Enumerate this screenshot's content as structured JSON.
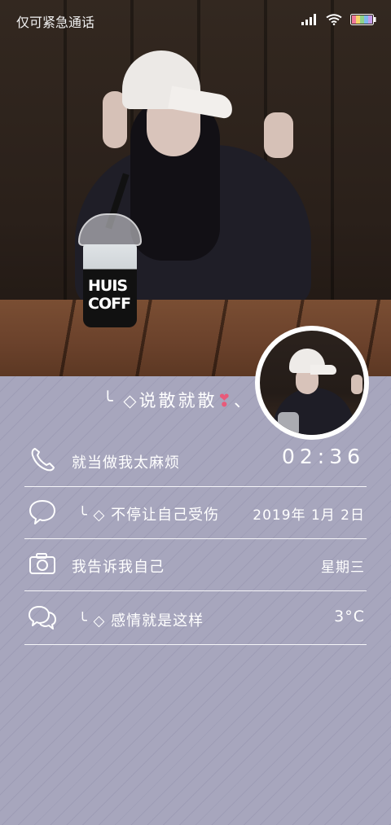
{
  "status_bar": {
    "carrier_text": "仅可紧急通话",
    "icons": [
      "signal-icon",
      "wifi-icon",
      "battery-icon"
    ]
  },
  "wallpaper": {
    "cup_text_line1": "HUIS",
    "cup_text_line2": "COFF"
  },
  "widget": {
    "headline_prefix": "╰ ◇说散就散",
    "headline_heart": "❣",
    "headline_suffix": "、",
    "rows": [
      {
        "icon": "phone-icon",
        "label": "就当做我太麻烦",
        "value": "02:36"
      },
      {
        "icon": "chat-icon",
        "label": "╰ ◇ 不停让自己受伤",
        "value": "2019年 1月 2日"
      },
      {
        "icon": "camera-icon",
        "label": "我告诉我自己",
        "value": "星期三"
      },
      {
        "icon": "messages-icon",
        "label": "╰ ◇ 感情就是这样",
        "value": "3°C"
      }
    ]
  },
  "colors": {
    "panel_bg": "#a7a6bd",
    "text": "#ffffff",
    "heart": "#e85a7a"
  }
}
